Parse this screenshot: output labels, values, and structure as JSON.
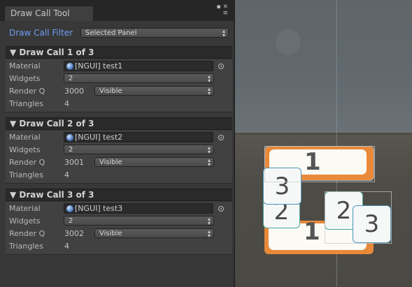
{
  "window": {
    "tab_title": "Draw Call Tool",
    "window_buttons": "▪ ✕\n≡"
  },
  "filter": {
    "label": "Draw Call Filter",
    "value": "Selected Panel"
  },
  "labels": {
    "material": "Material",
    "widgets": "Widgets",
    "render_q": "Render Q",
    "triangles": "Triangles"
  },
  "draw_calls": [
    {
      "header": "▼ Draw Call 1 of 3",
      "material": "[NGUI] test1",
      "widgets": "2",
      "render_q": "3000",
      "visibility": "Visible",
      "triangles": "4"
    },
    {
      "header": "▼ Draw Call 2 of 3",
      "material": "[NGUI] test2",
      "widgets": "2",
      "render_q": "3001",
      "visibility": "Visible",
      "triangles": "4"
    },
    {
      "header": "▼ Draw Call 3 of 3",
      "material": "[NGUI] test3",
      "widgets": "2",
      "render_q": "3002",
      "visibility": "Visible",
      "triangles": "4"
    }
  ],
  "scene": {
    "sprite_labels": [
      "1",
      "1",
      "3",
      "2",
      "2",
      "3"
    ]
  },
  "colors": {
    "filter_label": "#6f9ef5",
    "sprite_border_orange": "#e98a3b",
    "tile_border_teal": "#4aa89c"
  }
}
